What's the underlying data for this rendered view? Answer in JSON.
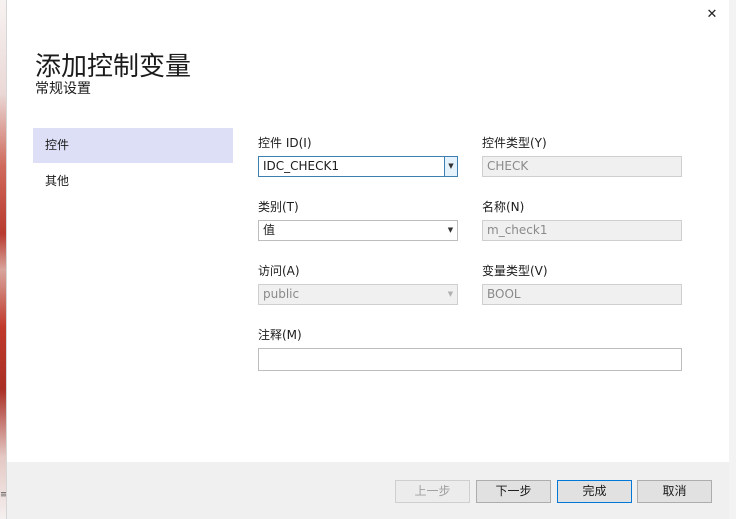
{
  "dialog": {
    "close_glyph": "✕",
    "title": "添加控制变量",
    "subtitle": "常规设置"
  },
  "nav": {
    "items": [
      {
        "label": "控件",
        "selected": true
      },
      {
        "label": "其他",
        "selected": false
      }
    ]
  },
  "form": {
    "control_id": {
      "label": "控件 ID(I)",
      "value": "IDC_CHECK1"
    },
    "control_type": {
      "label": "控件类型(Y)",
      "value": "CHECK"
    },
    "category": {
      "label": "类别(T)",
      "value": "值"
    },
    "name": {
      "label": "名称(N)",
      "value": "m_check1"
    },
    "access": {
      "label": "访问(A)",
      "value": "public"
    },
    "variable_type": {
      "label": "变量类型(V)",
      "value": "BOOL"
    },
    "comment": {
      "label": "注释(M)",
      "value": ""
    }
  },
  "footer": {
    "prev_label": "上一步",
    "next_label": "下一步",
    "finish_label": "完成",
    "cancel_label": "取消"
  },
  "background": {
    "edge_text": "≡"
  },
  "icons": {
    "close": "close-icon",
    "dropdown": "chevron-down-icon"
  },
  "colors": {
    "nav_selected": "#dcdff6",
    "focus_border": "#3c7fb1",
    "footer_bg": "#f0f0f0"
  }
}
